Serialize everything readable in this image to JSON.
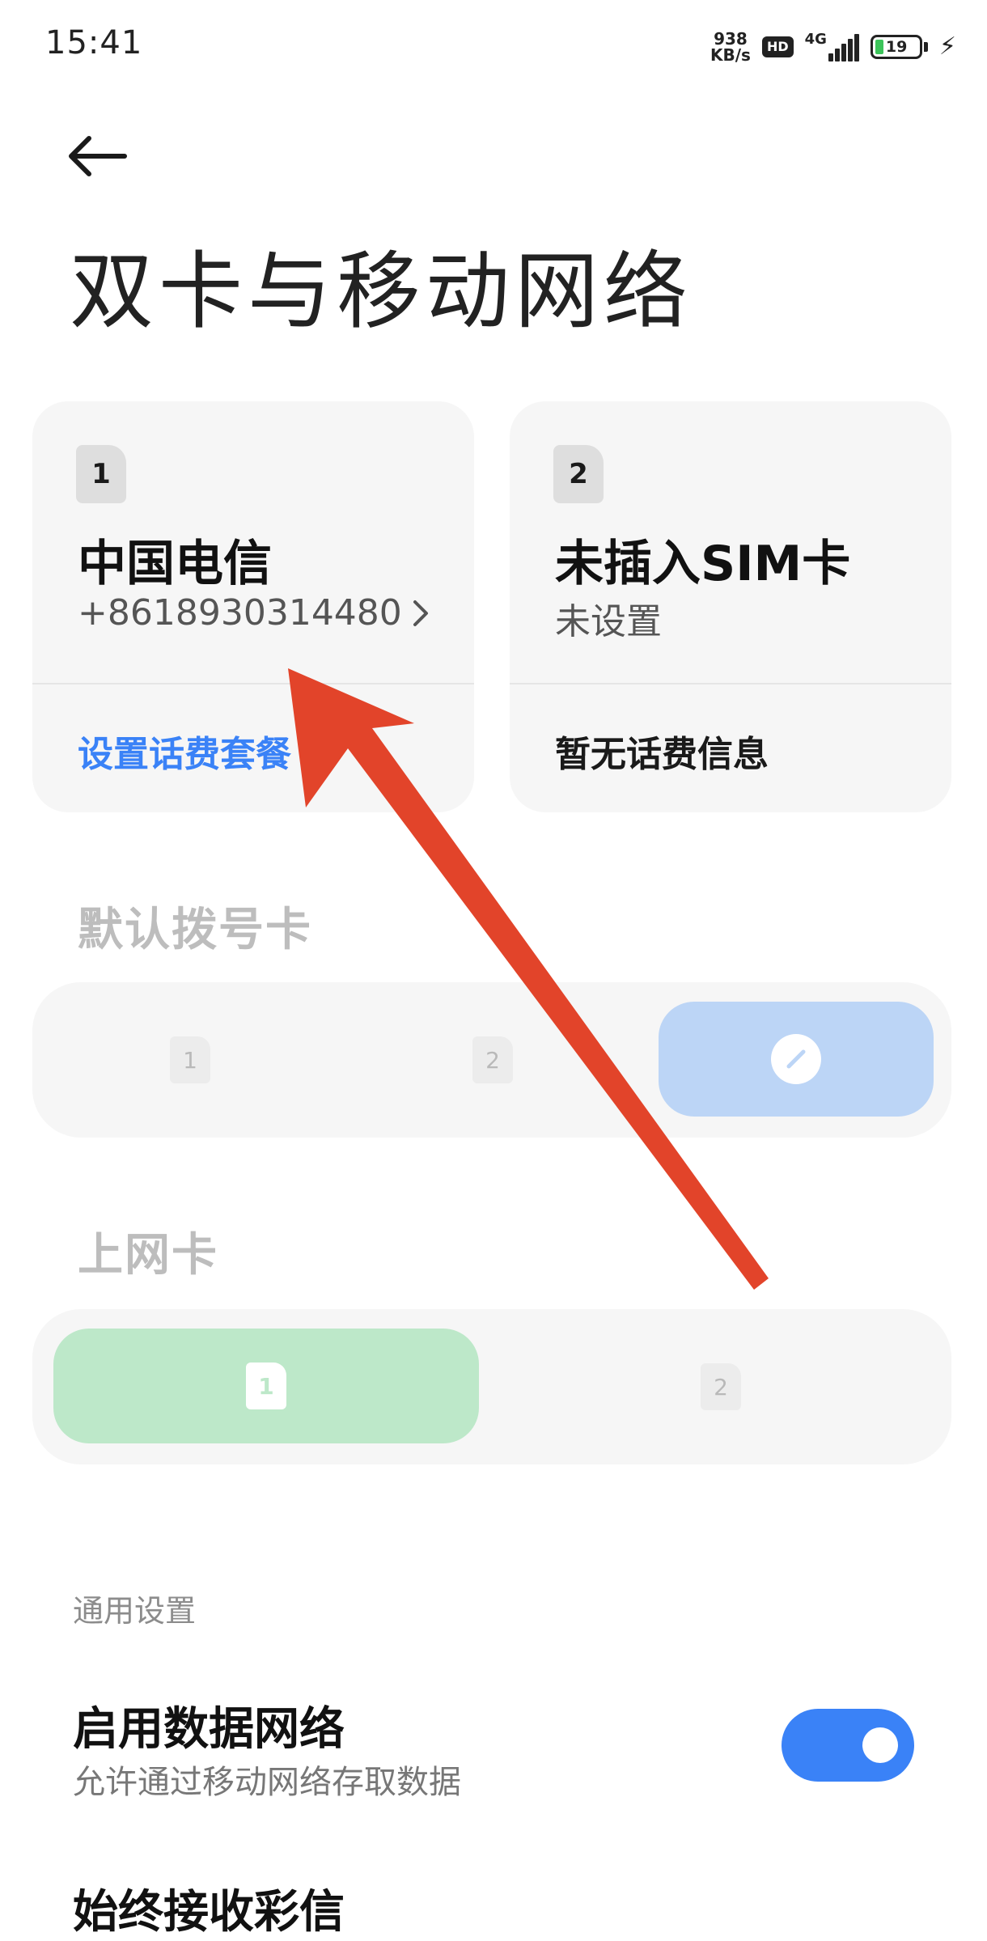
{
  "status_bar": {
    "time": "15:41",
    "speed_value": "938",
    "speed_unit": "KB/s",
    "hd": "HD",
    "network_type": "4G",
    "battery": "19"
  },
  "header": {
    "back_icon": "arrow-left-icon",
    "title": "双卡与移动网络"
  },
  "sim_cards": [
    {
      "slot": "1",
      "name": "中国电信",
      "subtitle": "+8618930314480",
      "footer": "设置话费套餐",
      "footer_color": "#3a82f7"
    },
    {
      "slot": "2",
      "name": "未插入SIM卡",
      "subtitle": "未设置",
      "footer": "暂无话费信息",
      "footer_color": "#1a1a1a"
    }
  ],
  "default_dial": {
    "label": "默认拨号卡",
    "options": [
      "1",
      "2"
    ],
    "selected_icon": "edit-icon"
  },
  "data_card": {
    "label": "上网卡",
    "selected": "1",
    "other": "2"
  },
  "general": {
    "section_label": "通用设置",
    "rows": [
      {
        "title": "启用数据网络",
        "subtitle": "允许通过移动网络存取数据",
        "toggle_on": true
      },
      {
        "title": "始终接收彩信"
      }
    ]
  },
  "colors": {
    "accent_blue": "#3a82f7",
    "annotation_arrow": "#e2442a",
    "data_card_green": "#bde8c9",
    "dial_card_blue": "#bcd5f6"
  }
}
